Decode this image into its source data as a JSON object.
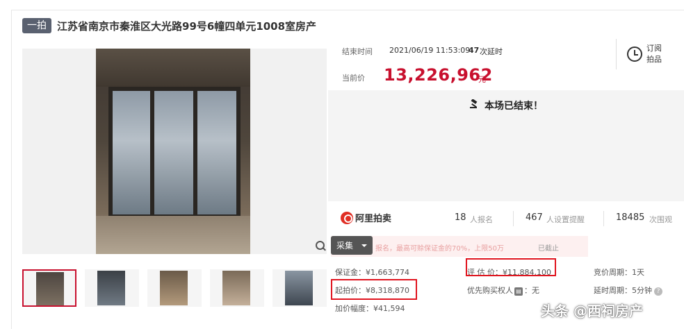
{
  "title": {
    "badge": "一拍",
    "text": "江苏省南京市秦淮区大光路99号6幢四单元1008室房产"
  },
  "auction": {
    "end_label": "结束时间",
    "end_time": "2021/06/19 11:53:09",
    "delay_count": "47",
    "delay_label": "次延时",
    "current_label": "当前价",
    "current_price": "13,226,962",
    "currency_unit": "元",
    "subscribe_label": "订阅拍品",
    "ended_text": "本场已结束！"
  },
  "stats": {
    "logo_text": "阿里拍卖",
    "signups": "18",
    "signups_label": "人报名",
    "reminders": "467",
    "reminders_label": "人设置提醒",
    "views": "18485",
    "views_label": "次围观"
  },
  "notice": {
    "text": "报名，最高可赊保证金的70%，上限50万",
    "status": "已截止"
  },
  "collect": {
    "label": "采集"
  },
  "fields": {
    "deposit": "保证金：¥1,663,774",
    "start_price": "起拍价：¥8,318,870",
    "increment": "加价幅度：¥41,594",
    "appraisal": "评 估 价：¥11,884,100",
    "priority": "优先购买权人",
    "priority_value": "无",
    "bid_period": "竞价周期：1天",
    "delay_period": "延时周期：5分钟"
  },
  "watermark": "头条 @西祠房产",
  "colors": {
    "price_red": "#c8102e",
    "highlight_box": "#e0141e",
    "badge_bg": "#5a6170"
  }
}
